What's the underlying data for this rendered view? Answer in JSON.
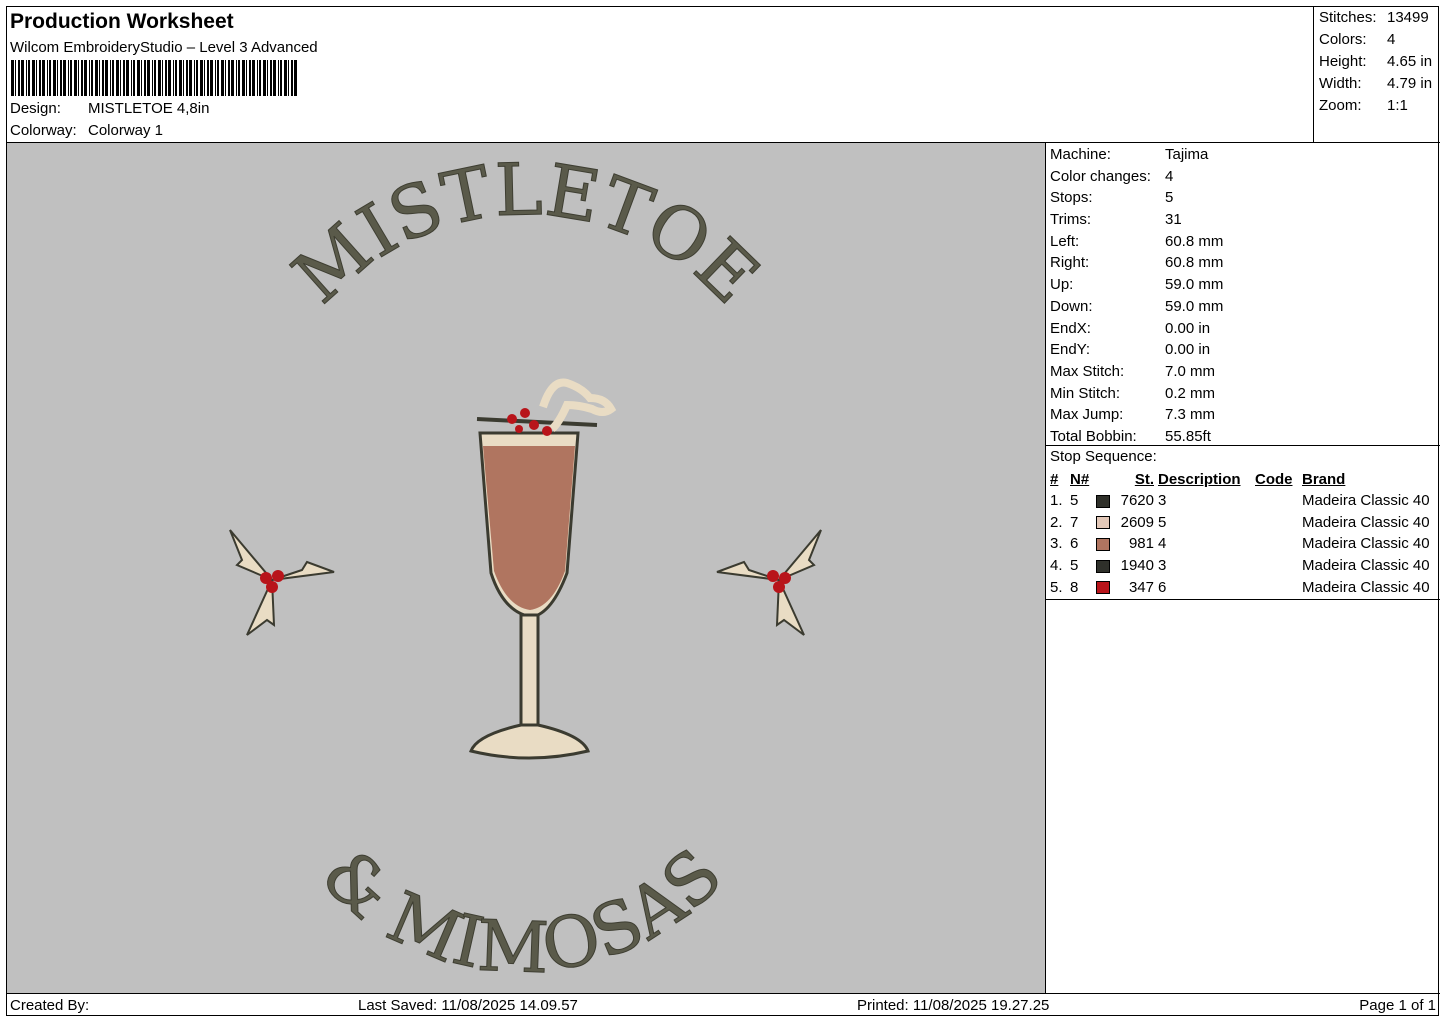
{
  "header": {
    "title": "Production Worksheet",
    "software": "Wilcom EmbroideryStudio – Level 3 Advanced",
    "design_label": "Design:",
    "design_value": "MISTLETOE 4,8in",
    "colorway_label": "Colorway:",
    "colorway_value": "Colorway 1"
  },
  "summary": [
    {
      "key": "Stitches:",
      "value": "13499"
    },
    {
      "key": "Colors:",
      "value": "4"
    },
    {
      "key": "Height:",
      "value": "4.65 in"
    },
    {
      "key": "Width:",
      "value": "4.79 in"
    },
    {
      "key": "Zoom:",
      "value": "1:1"
    }
  ],
  "machine": [
    {
      "key": "Machine:",
      "value": "Tajima"
    },
    {
      "key": "Color changes:",
      "value": "4"
    },
    {
      "key": "Stops:",
      "value": "5"
    },
    {
      "key": "Trims:",
      "value": "31"
    },
    {
      "key": "Left:",
      "value": "60.8 mm"
    },
    {
      "key": "Right:",
      "value": "60.8 mm"
    },
    {
      "key": "Up:",
      "value": "59.0 mm"
    },
    {
      "key": "Down:",
      "value": "59.0 mm"
    },
    {
      "key": "EndX:",
      "value": "0.00 in"
    },
    {
      "key": "EndY:",
      "value": "0.00 in"
    },
    {
      "key": "Max Stitch:",
      "value": "7.0 mm"
    },
    {
      "key": "Min Stitch:",
      "value": "0.2 mm"
    },
    {
      "key": "Max Jump:",
      "value": "7.3 mm"
    },
    {
      "key": "Total Bobbin:",
      "value": "55.85ft"
    }
  ],
  "stop_sequence": {
    "title": "Stop Sequence:",
    "headers": {
      "idx": "#",
      "n": "N#",
      "st": "St.",
      "desc": "Description",
      "code": "Code",
      "brand": "Brand"
    },
    "rows": [
      {
        "idx": "1.",
        "n": "5",
        "color": "#2f302a",
        "st": "7620",
        "desc": "3",
        "code": "",
        "brand": "Madeira Classic 40"
      },
      {
        "idx": "2.",
        "n": "7",
        "color": "#e3c8b8",
        "st": "2609",
        "desc": "5",
        "code": "",
        "brand": "Madeira Classic 40"
      },
      {
        "idx": "3.",
        "n": "6",
        "color": "#b07560",
        "st": "981",
        "desc": "4",
        "code": "",
        "brand": "Madeira Classic 40"
      },
      {
        "idx": "4.",
        "n": "5",
        "color": "#2f302a",
        "st": "1940",
        "desc": "3",
        "code": "",
        "brand": "Madeira Classic 40"
      },
      {
        "idx": "5.",
        "n": "8",
        "color": "#b8141a",
        "st": "347",
        "desc": "6",
        "code": "",
        "brand": "Madeira Classic 40"
      }
    ]
  },
  "design": {
    "top_text": "MISTLETOE",
    "bottom_text": "& MIMOSAS",
    "thread_dark": "#5a5a4a",
    "thread_cream": "#e9dcc4",
    "thread_rose": "#b07560",
    "thread_red": "#b8141a",
    "background": "#c0c0c0"
  },
  "footer": {
    "created": "Created By:",
    "saved": "Last Saved: 11/08/2025 14.09.57",
    "printed": "Printed: 11/08/2025 19.27.25",
    "page": "Page 1 of 1"
  }
}
